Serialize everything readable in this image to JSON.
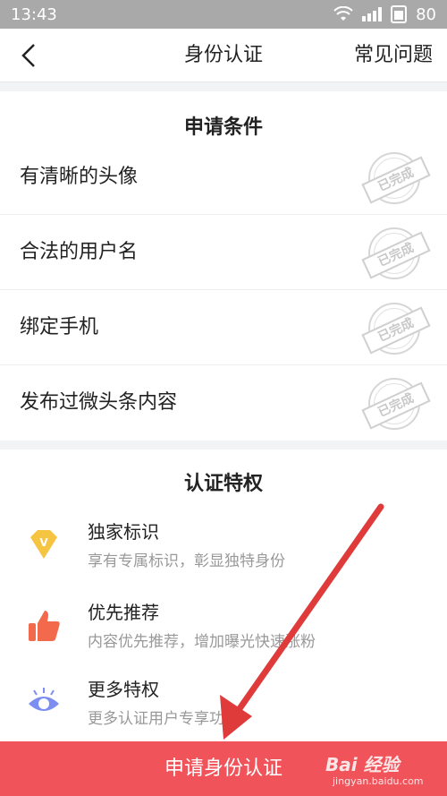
{
  "status_bar": {
    "time": "13:43",
    "battery": "80"
  },
  "nav": {
    "title": "身份认证",
    "faq": "常见问题"
  },
  "conditions": {
    "title": "申请条件",
    "stamp_text": "已完成",
    "items": [
      {
        "label": "有清晰的头像"
      },
      {
        "label": "合法的用户名"
      },
      {
        "label": "绑定手机"
      },
      {
        "label": "发布过微头条内容"
      }
    ]
  },
  "privileges": {
    "title": "认证特权",
    "items": [
      {
        "title": "独家标识",
        "desc": "享有专属标识，彰显独特身份",
        "icon": "diamond-v-icon"
      },
      {
        "title": "优先推荐",
        "desc": "内容优先推荐，增加曝光快速涨粉",
        "icon": "thumbs-up-icon"
      },
      {
        "title": "更多特权",
        "desc": "更多认证用户专享功能",
        "icon": "eye-icon"
      }
    ]
  },
  "apply_button": "申请身份认证",
  "watermark": {
    "brand": "Bai 经验",
    "sub": "jingyan.baidu.com"
  },
  "colors": {
    "accent": "#f0535a",
    "arrow": "#e03b3b"
  }
}
